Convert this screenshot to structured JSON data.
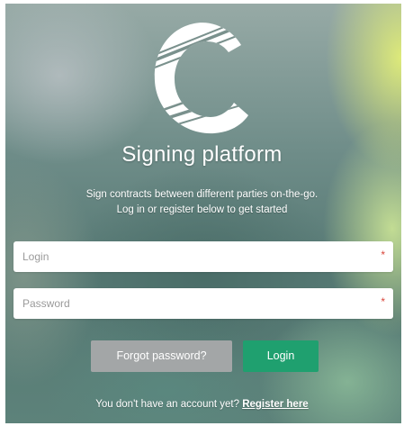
{
  "brand": {
    "logo_icon": "c-logo-icon",
    "logo_color": "#ffffff"
  },
  "header": {
    "title": "Signing platform",
    "subtitle_line1": "Sign contracts between different parties on-the-go.",
    "subtitle_line2": "Log in or register below to get started"
  },
  "form": {
    "login_placeholder": "Login",
    "login_value": "",
    "password_placeholder": "Password",
    "password_value": "",
    "required_marker": "*",
    "required_color": "#d9453a"
  },
  "buttons": {
    "forgot_label": "Forgot password?",
    "forgot_color": "#a3a6a7",
    "login_label": "Login",
    "login_color": "#1fa06f"
  },
  "footer": {
    "prompt": "You don't have an account yet?",
    "register_label": "Register here"
  }
}
